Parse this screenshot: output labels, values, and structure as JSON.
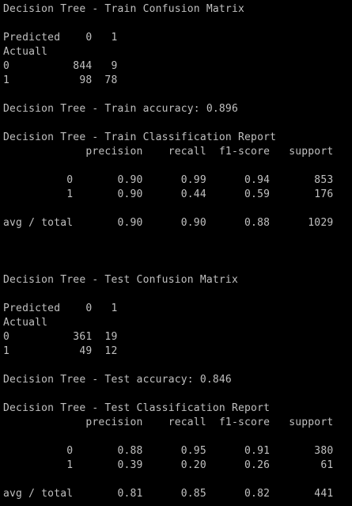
{
  "colors": {
    "background": "#000000",
    "text": "#c0c0c0"
  },
  "console_lines": [
    "Decision Tree - Train Confusion Matrix",
    "",
    "Predicted    0   1",
    "Actuall",
    "0          844   9",
    "1           98  78",
    "",
    "Decision Tree - Train accuracy: 0.896",
    "",
    "Decision Tree - Train Classification Report",
    "             precision    recall  f1-score   support",
    "",
    "          0       0.90      0.99      0.94       853",
    "          1       0.90      0.44      0.59       176",
    "",
    "avg / total       0.90      0.90      0.88      1029",
    "",
    "",
    "",
    "Decision Tree - Test Confusion Matrix",
    "",
    "Predicted    0   1",
    "Actuall",
    "0          361  19",
    "1           49  12",
    "",
    "Decision Tree - Test accuracy: 0.846",
    "",
    "Decision Tree - Test Classification Report",
    "             precision    recall  f1-score   support",
    "",
    "          0       0.88      0.95      0.91       380",
    "          1       0.39      0.20      0.26        61",
    "",
    "avg / total       0.81      0.85      0.82       441"
  ]
}
